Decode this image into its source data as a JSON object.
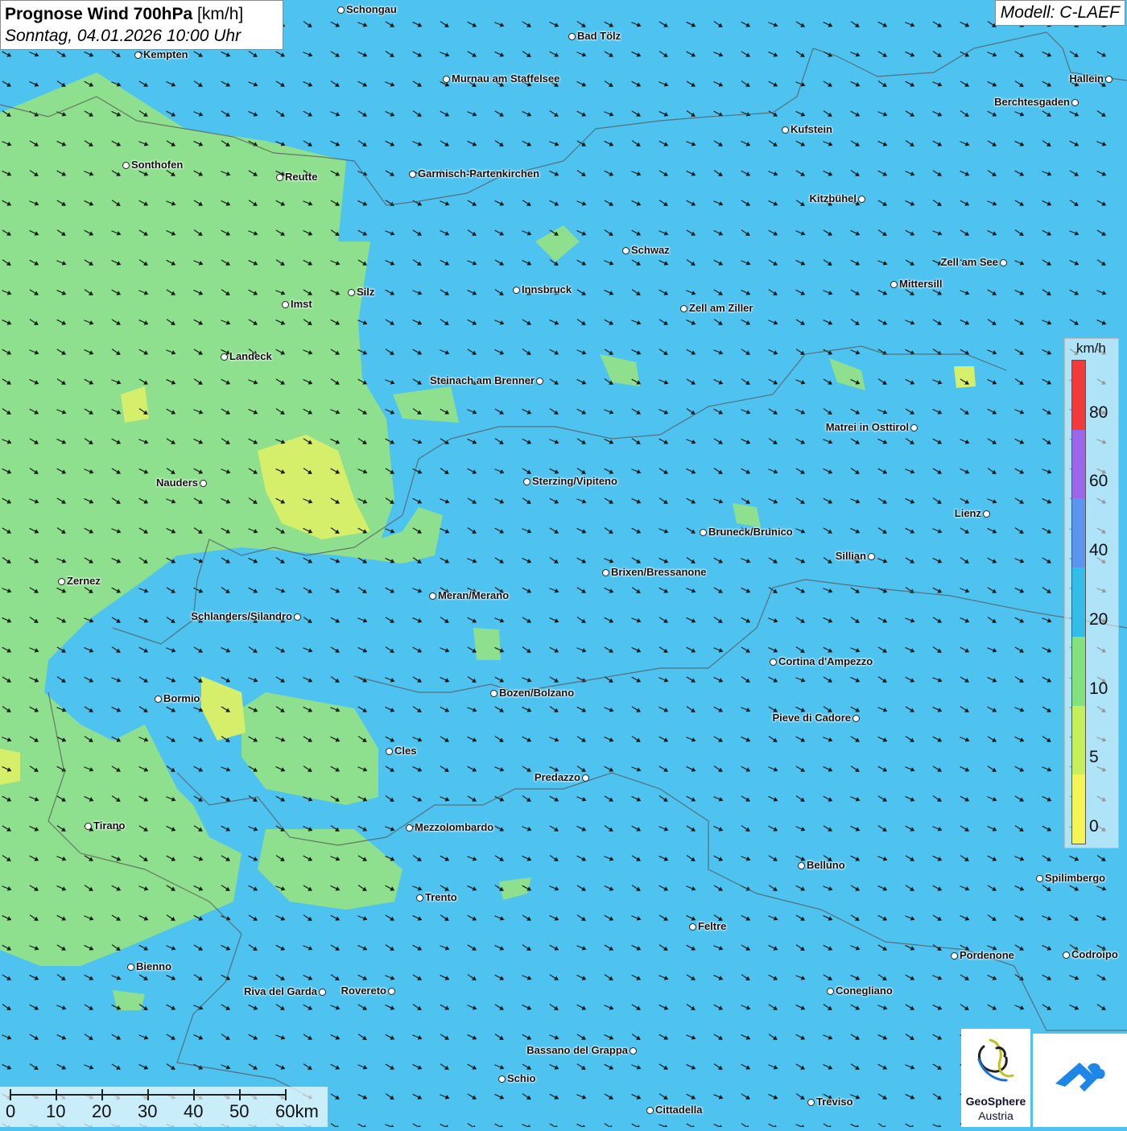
{
  "header": {
    "title_bold": "Prognose Wind 700hPa",
    "title_unit": "[km/h]",
    "subtitle": "Sonntag, 04.01.2026 10:00 Uhr",
    "model": "Modell: C-LAEF"
  },
  "legend": {
    "unit": "km/h",
    "labels": [
      "80",
      "60",
      "40",
      "20",
      "10",
      "5",
      "0"
    ],
    "colors": [
      "#f23a3a",
      "#9b66ea",
      "#5b95ef",
      "#35bde9",
      "#84e27e",
      "#c6ef5c",
      "#f4f455"
    ]
  },
  "scale": {
    "labels": [
      "0",
      "10",
      "20",
      "30",
      "40",
      "50",
      "60km"
    ]
  },
  "logos": {
    "geosphere_line1": "GeoSphere",
    "geosphere_line2": "Austria"
  },
  "map": {
    "wind_direction": "from northwest (arrows pointing south-east)",
    "background_color": "#4ec3ef",
    "low_wind_color": "#8ee08e"
  },
  "cities": [
    {
      "name": "Schongau"
    },
    {
      "name": "Bad Tölz"
    },
    {
      "name": "Kempten"
    },
    {
      "name": "Murnau am Staffelsee"
    },
    {
      "name": "Hallein"
    },
    {
      "name": "Berchtesgaden"
    },
    {
      "name": "Kufstein"
    },
    {
      "name": "Sonthofen"
    },
    {
      "name": "Reutte"
    },
    {
      "name": "Garmisch-Partenkirchen"
    },
    {
      "name": "Kitzbühel"
    },
    {
      "name": "Schwaz"
    },
    {
      "name": "Zell am See"
    },
    {
      "name": "Mittersill"
    },
    {
      "name": "Innsbruck"
    },
    {
      "name": "Silz"
    },
    {
      "name": "Imst"
    },
    {
      "name": "Zell am Ziller"
    },
    {
      "name": "Landeck"
    },
    {
      "name": "Steinach am Brenner"
    },
    {
      "name": "Matrei in Osttirol"
    },
    {
      "name": "Nauders"
    },
    {
      "name": "Sterzing/Vipiteno"
    },
    {
      "name": "Lienz"
    },
    {
      "name": "Bruneck/Brunico"
    },
    {
      "name": "Sillian"
    },
    {
      "name": "Zernez"
    },
    {
      "name": "Brixen/Bressanone"
    },
    {
      "name": "Meran/Merano"
    },
    {
      "name": "Schlanders/Silandro"
    },
    {
      "name": "Cortina d'Ampezzo"
    },
    {
      "name": "Bozen/Bolzano"
    },
    {
      "name": "Bormio"
    },
    {
      "name": "Pieve di Cadore"
    },
    {
      "name": "Cles"
    },
    {
      "name": "Predazzo"
    },
    {
      "name": "Tirano"
    },
    {
      "name": "Mezzolombardo"
    },
    {
      "name": "Belluno"
    },
    {
      "name": "Spilimbergo"
    },
    {
      "name": "Trento"
    },
    {
      "name": "Feltre"
    },
    {
      "name": "Pordenone"
    },
    {
      "name": "Codroipo"
    },
    {
      "name": "Bienno"
    },
    {
      "name": "Riva del Garda"
    },
    {
      "name": "Rovereto"
    },
    {
      "name": "Conegliano"
    },
    {
      "name": "Bassano del Grappa"
    },
    {
      "name": "Schio"
    },
    {
      "name": "Treviso"
    },
    {
      "name": "Cittadella"
    }
  ]
}
